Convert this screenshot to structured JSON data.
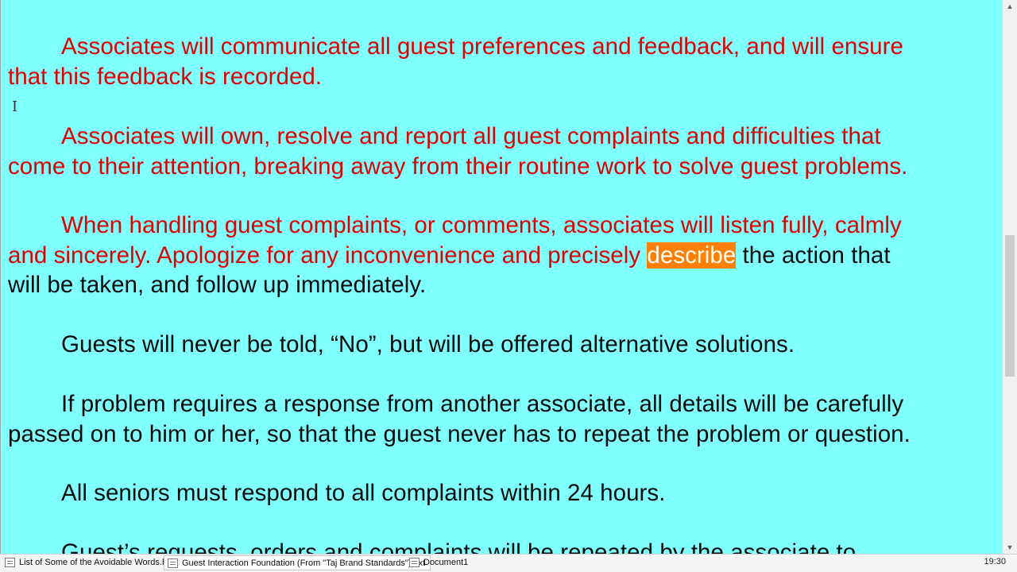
{
  "document": {
    "paragraphs": [
      {
        "lines": [
          [
            {
              "text": "Associates will communicate all guest preferences and feedback, and will ensure",
              "color": "red"
            }
          ],
          [
            {
              "text": "that this feedback is recorded.",
              "color": "red"
            }
          ]
        ]
      },
      {
        "lines": [
          [
            {
              "text": "Associates will own, resolve and report all guest complaints and difficulties that",
              "color": "red"
            }
          ],
          [
            {
              "text": "come to their attention, breaking away from their routine work to solve guest problems.",
              "color": "red"
            }
          ]
        ]
      },
      {
        "lines": [
          [
            {
              "text": "When handling guest complaints, or comments, associates will listen fully, calmly",
              "color": "red"
            }
          ],
          [
            {
              "text": "and sincerely. Apologize for any inconvenience and precisely ",
              "color": "red"
            },
            {
              "text": "describe",
              "color": "highlight"
            },
            {
              "text": " the action that",
              "color": "black"
            }
          ],
          [
            {
              "text": "will be taken, and follow up immediately.",
              "color": "black"
            }
          ]
        ]
      },
      {
        "lines": [
          [
            {
              "text": "Guests will never be told, “No”, but will be offered alternative solutions.",
              "color": "black"
            }
          ]
        ]
      },
      {
        "lines": [
          [
            {
              "text": "If problem requires a response from another associate, all details will be carefully",
              "color": "black"
            }
          ],
          [
            {
              "text": "passed on to him or her, so that the guest never has to repeat the problem or question.",
              "color": "black"
            }
          ]
        ]
      },
      {
        "lines": [
          [
            {
              "text": "All seniors must respond to all complaints within 24 hours.",
              "color": "black"
            }
          ]
        ]
      },
      {
        "lines": [
          [
            {
              "text": "Guest’s requests, orders and complaints will be repeated by the associate to",
              "color": "black"
            }
          ]
        ]
      }
    ]
  },
  "taskbar": {
    "tabs": [
      {
        "label": "List of Some of the Avoidable Words.bxt",
        "active": false
      },
      {
        "label": "Guest Interaction Foundation (From \"Taj Brand Standards\").bxt",
        "active": true
      },
      {
        "label": "Document1",
        "active": false
      }
    ],
    "clock": "19:30"
  },
  "colors": {
    "page_background": "#80ffff",
    "red_text": "#e00000",
    "black_text": "#0b0b0b",
    "highlight_background": "#ff8000",
    "highlight_text": "#ffffff"
  }
}
